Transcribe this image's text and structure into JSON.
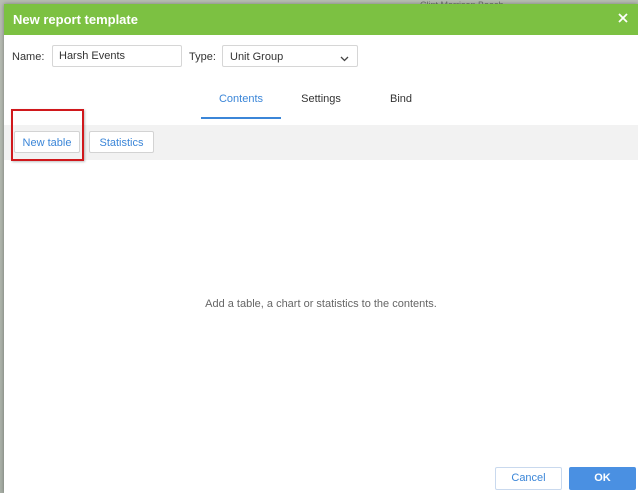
{
  "background": {
    "map_label": "Clint Morrison Beach"
  },
  "dialog": {
    "title": "New report template",
    "close_icon": "close-icon",
    "accent_color": "#7cc142"
  },
  "form": {
    "name_label": "Name:",
    "name_value": "Harsh Events",
    "type_label": "Type:",
    "type_value": "Unit Group"
  },
  "tabs": [
    {
      "label": "Contents",
      "active": true
    },
    {
      "label": "Settings",
      "active": false
    },
    {
      "label": "Bind",
      "active": false
    }
  ],
  "toolbar": {
    "new_table_label": "New table",
    "statistics_label": "Statistics"
  },
  "content": {
    "empty_message": "Add a table, a chart or statistics to the contents."
  },
  "footer": {
    "cancel_label": "Cancel",
    "ok_label": "OK"
  },
  "colors": {
    "link_blue": "#3b86d8",
    "primary_button": "#4a90e2",
    "highlight_red": "#d0181c"
  }
}
